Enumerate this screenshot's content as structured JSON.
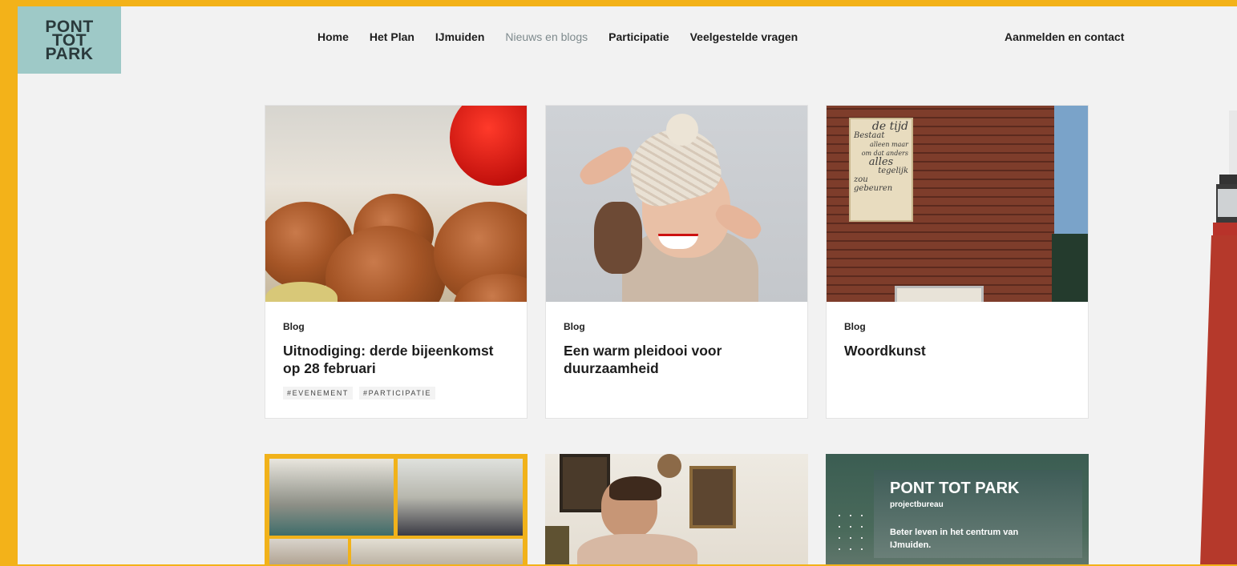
{
  "logo": {
    "line1": "PONT",
    "line2": "TOT",
    "line3": "PARK"
  },
  "nav": {
    "items": [
      {
        "label": "Home"
      },
      {
        "label": "Het Plan"
      },
      {
        "label": "IJmuiden"
      },
      {
        "label": "Nieuws en blogs"
      },
      {
        "label": "Participatie"
      },
      {
        "label": "Veelgestelde vragen"
      }
    ],
    "contact": "Aanmelden en contact"
  },
  "cards": [
    {
      "category": "Blog",
      "title": "Uitnodiging: derde bijeenkomst op 28 februari",
      "tags": [
        "#EVENEMENT",
        "#PARTICIPATIE"
      ]
    },
    {
      "category": "Blog",
      "title": "Een warm pleidooi voor duurzaamheid",
      "tags": []
    },
    {
      "category": "Blog",
      "title": "Woordkunst",
      "tags": []
    }
  ],
  "sign": {
    "text1": "de tijd",
    "text2": "Bestaat",
    "text3": "alleen maar",
    "text4": "om dat anders",
    "text5": "alles",
    "text6": "tegelijk",
    "text7": "zou gebeuren"
  },
  "storefront": {
    "brand": "PONT TOT PARK",
    "sub": "projectbureau",
    "tagline1": "Beter leven in het centrum van",
    "tagline2": "IJmuiden."
  },
  "colors": {
    "accent": "#f3b219",
    "logo_bg": "#9ec9c7"
  }
}
